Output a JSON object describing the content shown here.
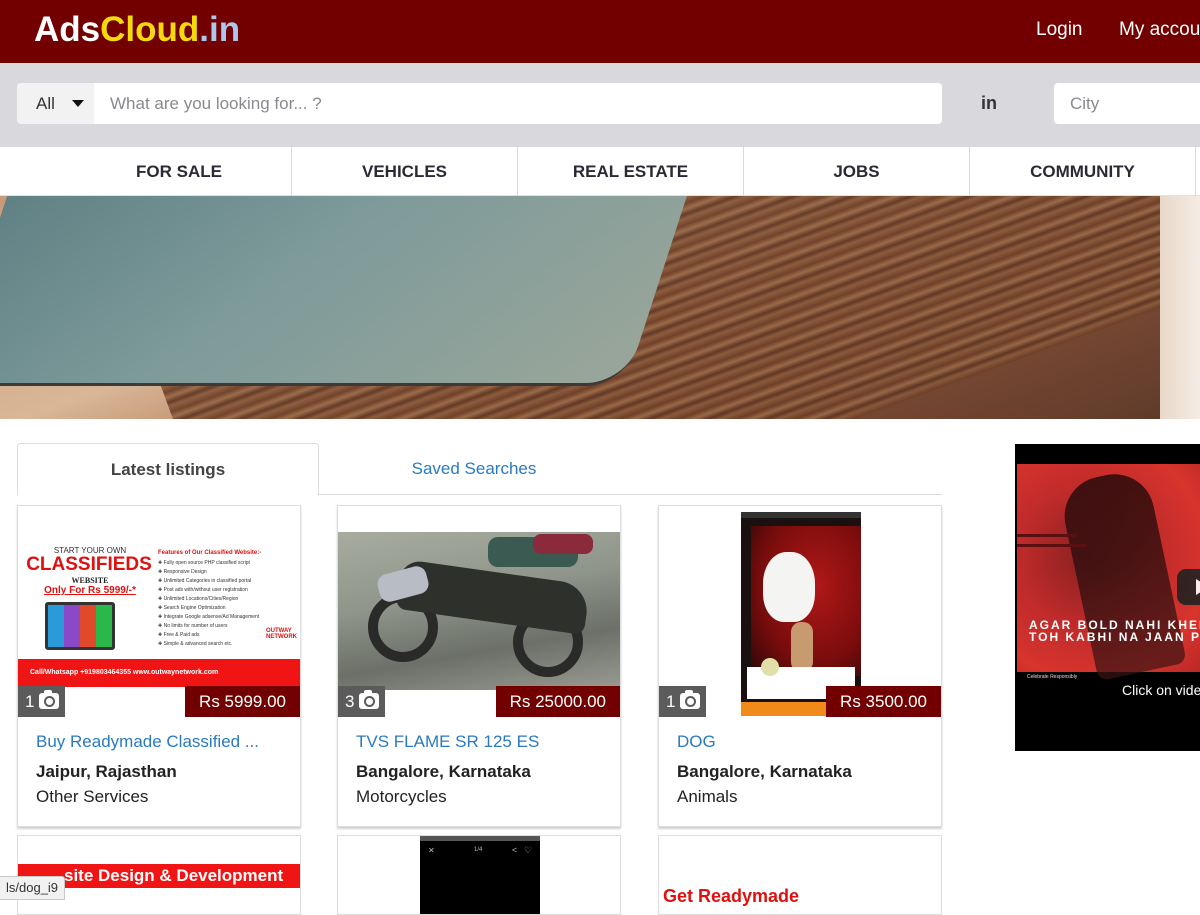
{
  "header": {
    "logo": {
      "part1": "Ads",
      "part2": "Cloud",
      "part3": ".in"
    },
    "links": [
      {
        "label": "Login"
      },
      {
        "label": "My account"
      }
    ]
  },
  "search": {
    "category_selected": "All",
    "query_value": "",
    "query_placeholder": "What are you looking for... ?",
    "in_label": "in",
    "city_value": "",
    "city_placeholder": "City"
  },
  "nav": {
    "items": [
      {
        "label": "FOR SALE"
      },
      {
        "label": "VEHICLES"
      },
      {
        "label": "REAL ESTATE"
      },
      {
        "label": "JOBS"
      },
      {
        "label": "COMMUNITY"
      }
    ]
  },
  "tabs": [
    {
      "label": "Latest listings",
      "active": true
    },
    {
      "label": "Saved Searches",
      "active": false
    }
  ],
  "listings": [
    {
      "title": "Buy Readymade Classified ...",
      "location": "Jaipur, Rajasthan",
      "category": "Other Services",
      "price": "Rs 5999.00",
      "photo_count": "1",
      "image_text": {
        "line1": "START YOUR OWN",
        "line2": "CLASSIFIEDS",
        "line3": "WEBSITE",
        "line4": "Only For Rs 5999/-*",
        "features_title": "Features of Our Classified Website:-",
        "features": [
          "Fully open source PHP classified script",
          "Responsive Design",
          "Unlimited Categories in classified portal",
          "Post ads with/without user registration",
          "Unlimited Locations/Cities/Region",
          "Search Engine Optimization",
          "Integrate Google adsense/Ad Management",
          "No limits for number of users",
          "Free & Paid ads",
          "Simple & advanced search etc."
        ],
        "contact": "Call/Whatsapp +919803464355 www.outwaynetwork.com",
        "brand": "OUTWAY NETWORK"
      }
    },
    {
      "title": "TVS FLAME SR 125 ES",
      "location": "Bangalore, Karnataka",
      "category": "Motorcycles",
      "price": "Rs 25000.00",
      "photo_count": "3"
    },
    {
      "title": "DOG",
      "location": "Bangalore, Karnataka",
      "category": "Animals",
      "price": "Rs 3500.00",
      "photo_count": "1"
    }
  ],
  "partial_listings": [
    {
      "image_text": "site Design & Development"
    },
    {
      "image_text": "1/4"
    },
    {
      "image_text": "Get Readymade"
    }
  ],
  "video_ad": {
    "overlay_line1": "AGAR BOLD NAHI KHEL",
    "overlay_line2": "TOH KABHI NA JAAN PA",
    "small_text": "Celebrate Responsibly",
    "cta": "Click on vide"
  },
  "status_bar": {
    "url": "ls/dog_i9"
  },
  "colors": {
    "brand": "#720000",
    "link": "#2a7ac0",
    "logo_yellow": "#f4d90f",
    "logo_blue": "#a8c8ec"
  }
}
